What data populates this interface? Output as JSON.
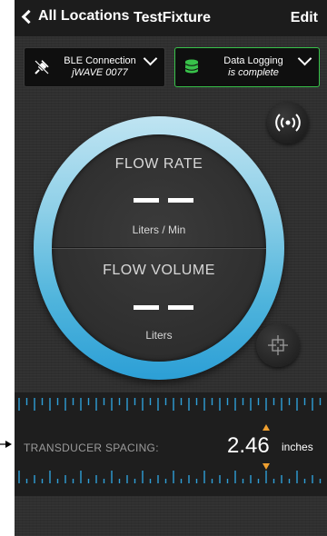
{
  "nav": {
    "back_label": "All Locations",
    "title": "TestFixture",
    "edit_label": "Edit"
  },
  "ble": {
    "line1": "BLE Connection",
    "line2": "jWAVE 0077"
  },
  "logging": {
    "line1": "Data Logging",
    "line2": "is complete",
    "accent": "#38c24a"
  },
  "gauge": {
    "flow_rate": {
      "title": "FLOW  RATE",
      "value": "— —",
      "unit": "Liters / Min"
    },
    "flow_volume": {
      "title": "FLOW VOLUME",
      "value": "— —",
      "unit": "Liters"
    },
    "ring_color": "#2c9fd6"
  },
  "spacing": {
    "label": "TRANSDUCER SPACING:",
    "value": "2.46",
    "unit": "inches",
    "arrow_color": "#f0a030",
    "ruler_color": "#2e9fd8"
  },
  "icons": {
    "back": "chevron-left-icon",
    "ble": "plug-disconnected-icon",
    "logging": "database-icon",
    "wireless": "wireless-signal-icon",
    "crosshair": "crosshair-icon",
    "pointer": "arrow-pointer-icon"
  }
}
